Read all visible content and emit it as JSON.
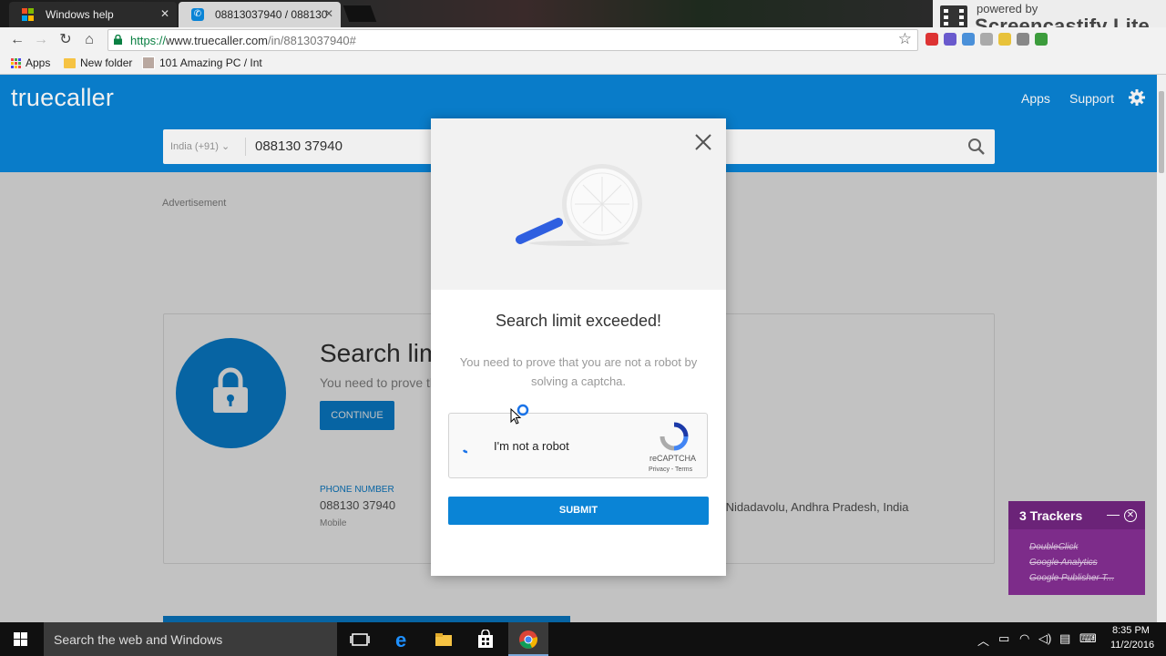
{
  "browser": {
    "tabs": [
      {
        "title": "Windows help"
      },
      {
        "title": "08813037940 / 088130"
      }
    ],
    "url": {
      "scheme": "https://",
      "host": "www.truecaller.com",
      "path": "/in/8813037940#"
    },
    "bookmarks": [
      {
        "label": "Apps"
      },
      {
        "label": "New folder"
      },
      {
        "label": "101 Amazing PC / Int"
      }
    ],
    "screencastify": {
      "line1": "powered by",
      "line2": "Screencastify Lite"
    }
  },
  "header": {
    "logo": "truecaller",
    "links": [
      "Apps",
      "Support"
    ],
    "search": {
      "country": "India (+91)",
      "number": "088130 37940"
    }
  },
  "page": {
    "advert_label": "Advertisement",
    "card": {
      "title": "Search lim",
      "subtitle": "You need to prove th",
      "continue_label": "CONTINUE",
      "phone_label": "PHONE NUMBER",
      "phone_value": "088130 37940",
      "phone_type": "Mobile",
      "location": "/Nidadavolu, Andhra Pradesh, India"
    }
  },
  "modal": {
    "title": "Search limit exceeded!",
    "text": "You need to prove that you are not a robot by solving a captcha.",
    "captcha": {
      "label": "I'm not a robot",
      "brand": "reCAPTCHA",
      "links": "Privacy - Terms"
    },
    "submit_label": "SUBMIT"
  },
  "trackers": {
    "title": "3 Trackers",
    "items": [
      "DoubleClick",
      "Google Analytics",
      "Google Publisher T..."
    ]
  },
  "taskbar": {
    "search_placeholder": "Search the web and Windows",
    "time": "8:35 PM",
    "date": "11/2/2016"
  },
  "colors": {
    "brand": "#0a84d6",
    "tracker_bg": "#7d2c8a"
  }
}
